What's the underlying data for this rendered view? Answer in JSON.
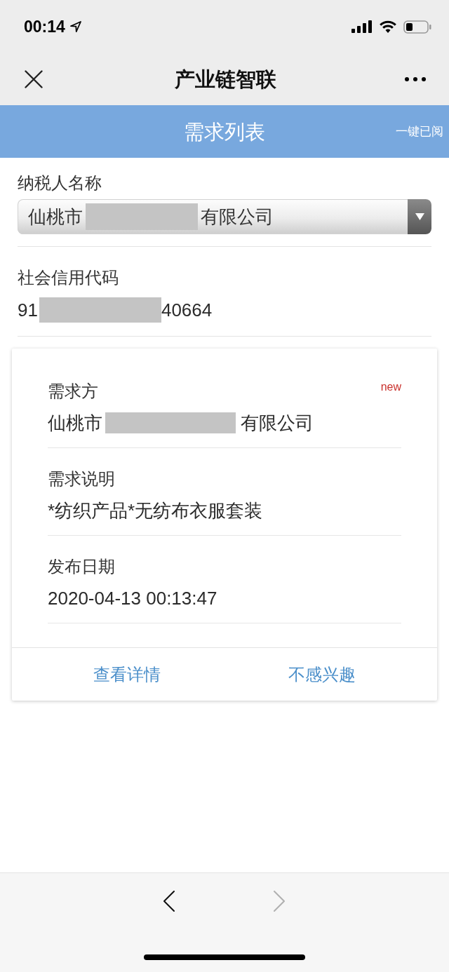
{
  "status_bar": {
    "time": "00:14"
  },
  "nav_bar": {
    "title": "产业链智联"
  },
  "header": {
    "title": "需求列表",
    "action": "一键已阅"
  },
  "form": {
    "fields": [
      {
        "kind": "select",
        "label": "纳税人名称",
        "value": [
          {
            "kind": "text",
            "text": "仙桃市"
          },
          {
            "kind": "redacted"
          },
          {
            "kind": "text",
            "text": "有限公司"
          }
        ]
      },
      {
        "kind": "text",
        "label": "社会信用代码",
        "value": [
          {
            "kind": "text",
            "text": "91"
          },
          {
            "kind": "redacted"
          },
          {
            "kind": "text",
            "text": "40664"
          }
        ]
      }
    ]
  },
  "demand_card": {
    "badge": "new",
    "fields": [
      {
        "label": "需求方",
        "value": [
          {
            "kind": "text",
            "text": "仙桃市"
          },
          {
            "kind": "redacted"
          },
          {
            "kind": "text",
            "text": "有限公司"
          }
        ]
      },
      {
        "label": "需求说明",
        "value": [
          {
            "kind": "text",
            "text": "*纺织产品*无纺布衣服套装"
          }
        ]
      },
      {
        "label": "发布日期",
        "value": [
          {
            "kind": "text",
            "text": "2020-04-13 00:13:47"
          }
        ]
      }
    ],
    "actions": [
      "查看详情",
      "不感兴趣"
    ]
  },
  "toolbar": {
    "buttons": [
      {
        "kind": "back",
        "disabled": false
      },
      {
        "kind": "forward",
        "disabled": true
      }
    ]
  }
}
